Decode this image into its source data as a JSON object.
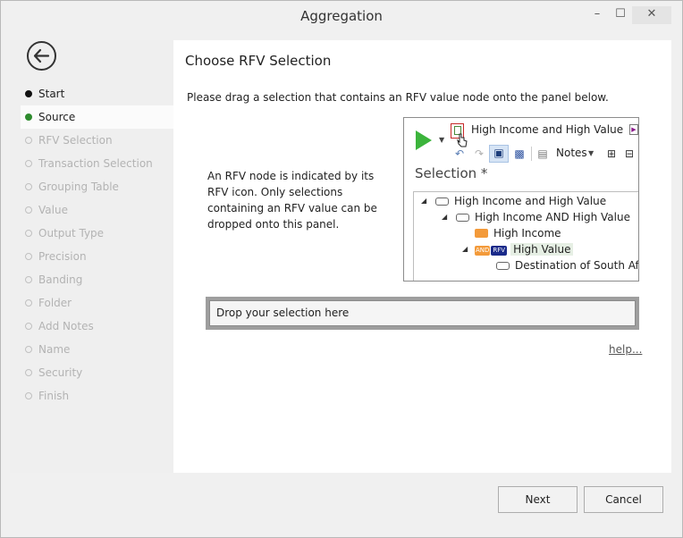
{
  "window": {
    "title": "Aggregation"
  },
  "sidebar": {
    "items": [
      {
        "label": "Start",
        "state": "done"
      },
      {
        "label": "Source",
        "state": "active"
      },
      {
        "label": "RFV Selection",
        "state": "pending"
      },
      {
        "label": "Transaction Selection",
        "state": "pending"
      },
      {
        "label": "Grouping Table",
        "state": "pending"
      },
      {
        "label": "Value",
        "state": "pending"
      },
      {
        "label": "Output Type",
        "state": "pending"
      },
      {
        "label": "Precision",
        "state": "pending"
      },
      {
        "label": "Banding",
        "state": "pending"
      },
      {
        "label": "Folder",
        "state": "pending"
      },
      {
        "label": "Add Notes",
        "state": "pending"
      },
      {
        "label": "Name",
        "state": "pending"
      },
      {
        "label": "Security",
        "state": "pending"
      },
      {
        "label": "Finish",
        "state": "pending"
      }
    ]
  },
  "main": {
    "title": "Choose RFV Selection",
    "instruction": "Please drag a selection that contains an RFV value node onto the panel below.",
    "explanation": "An RFV node is indicated by its RFV icon. Only selections containing an RFV value can be dropped onto this panel.",
    "preview": {
      "selection_name": "High Income and High Value",
      "notes_label": "Notes",
      "section_label": "Selection *",
      "tree": [
        {
          "label": "High Income and High Value"
        },
        {
          "label": "High Income AND High Value"
        },
        {
          "label": "High Income"
        },
        {
          "label": "High Value",
          "tag_and": "AND",
          "tag_rfv": "RFV"
        },
        {
          "label": "Destination of South Afric"
        }
      ]
    },
    "dropzone_text": "Drop your selection here",
    "help_link": "help..."
  },
  "footer": {
    "next_label": "Next",
    "cancel_label": "Cancel"
  },
  "colors": {
    "active_dot": "#2e8b2e",
    "rfv_tag": "#1a2a8a",
    "and_tag": "#f39a3a",
    "highlight": "#e6efe4"
  }
}
